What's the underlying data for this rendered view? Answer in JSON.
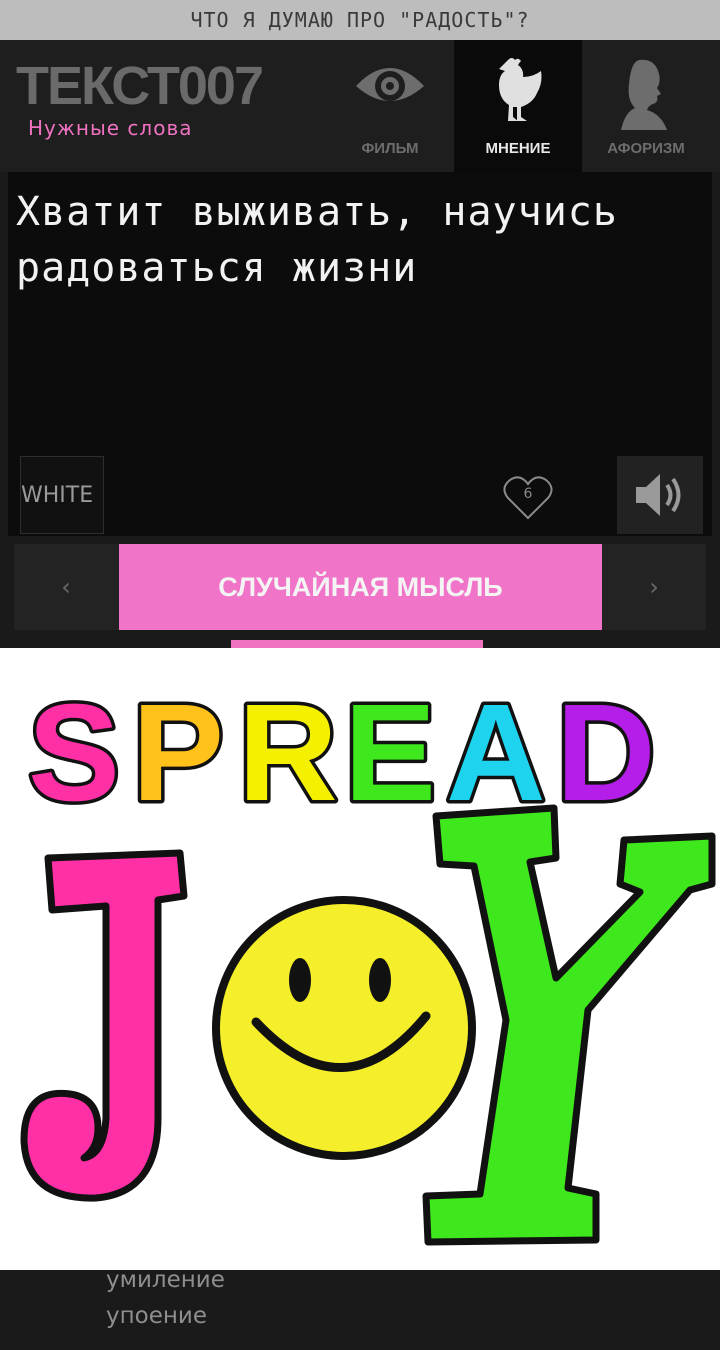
{
  "page_title": "ЧТО Я ДУМАЮ ПРО \"РАДОСТЬ\"?",
  "header": {
    "logo": "ТЕКСТ007",
    "tagline": "Нужные слова",
    "tabs": [
      {
        "label": "ФИЛЬМ",
        "icon": "eye-icon",
        "active": false
      },
      {
        "label": "МНЕНИЕ",
        "icon": "chicken-icon",
        "active": true
      },
      {
        "label": "АФОРИЗМ",
        "icon": "profile-bust-icon",
        "active": false
      }
    ]
  },
  "quote": {
    "line1": "Хватит выживать, научись",
    "line2": "радоваться жизни"
  },
  "controls": {
    "theme_label": "WHITE",
    "likes": "6",
    "like_icon": "heart-icon",
    "sound_icon": "speaker-icon"
  },
  "nav": {
    "prev": "‹",
    "next": "›",
    "random_label": "СЛУЧАЙНАЯ МЫСЛЬ"
  },
  "image": {
    "word1": "SPREAD",
    "word2": "JOY",
    "colors": [
      "#ff2fa6",
      "#ffc21a",
      "#f4f000",
      "#3ee81c",
      "#1ed3ee",
      "#b51ee8"
    ],
    "smiley_color": "#f4ef2a"
  },
  "list": [
    "умиление",
    "упоение"
  ]
}
